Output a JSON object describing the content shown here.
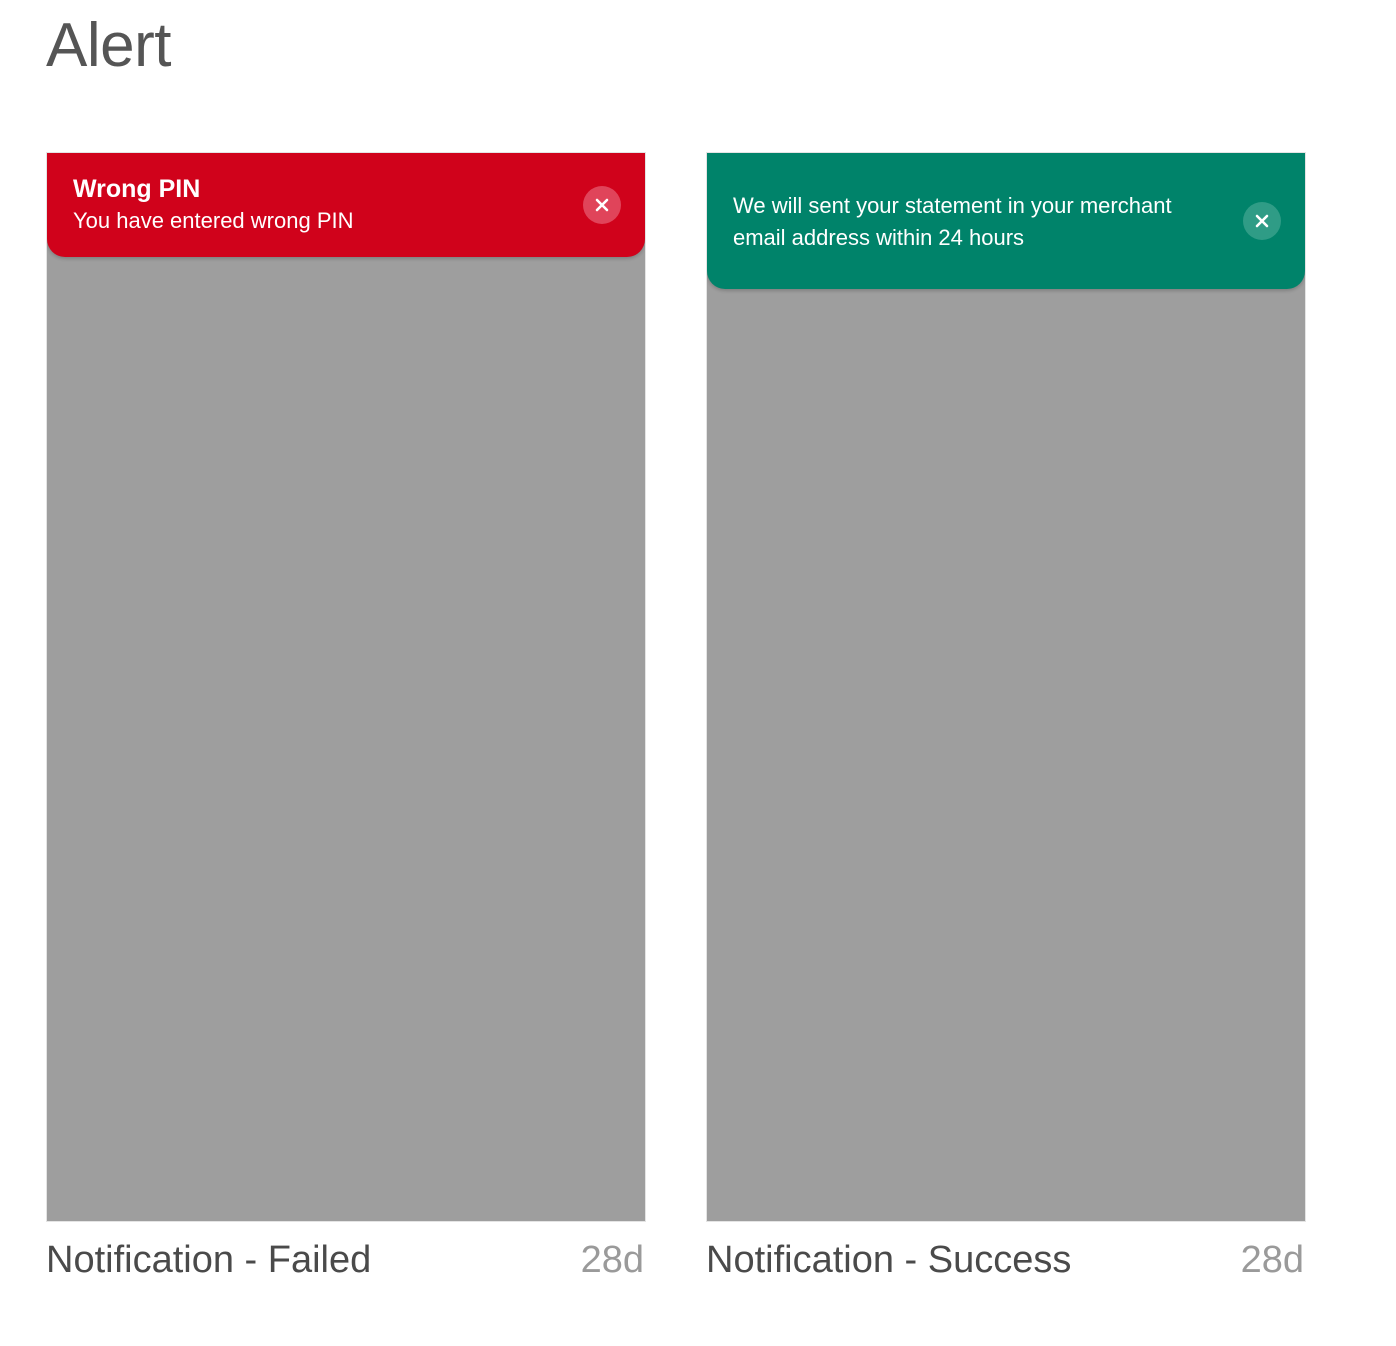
{
  "page": {
    "title": "Alert"
  },
  "cards": [
    {
      "caption": "Notification - Failed",
      "age": "28d",
      "banner": {
        "title": "Wrong PIN",
        "message": "You have entered wrong PIN",
        "color": "#d0021b",
        "close_bg": "#e0445a",
        "close_icon": "close-icon"
      },
      "preview_bg": "#9e9e9e"
    },
    {
      "caption": "Notification - Success",
      "age": "28d",
      "banner": {
        "message": "We will sent your statement in your merchant email address within 24 hours",
        "color": "#00836a",
        "close_bg": "#2f9c86",
        "close_icon": "close-icon"
      },
      "preview_bg": "#9e9e9e"
    }
  ]
}
